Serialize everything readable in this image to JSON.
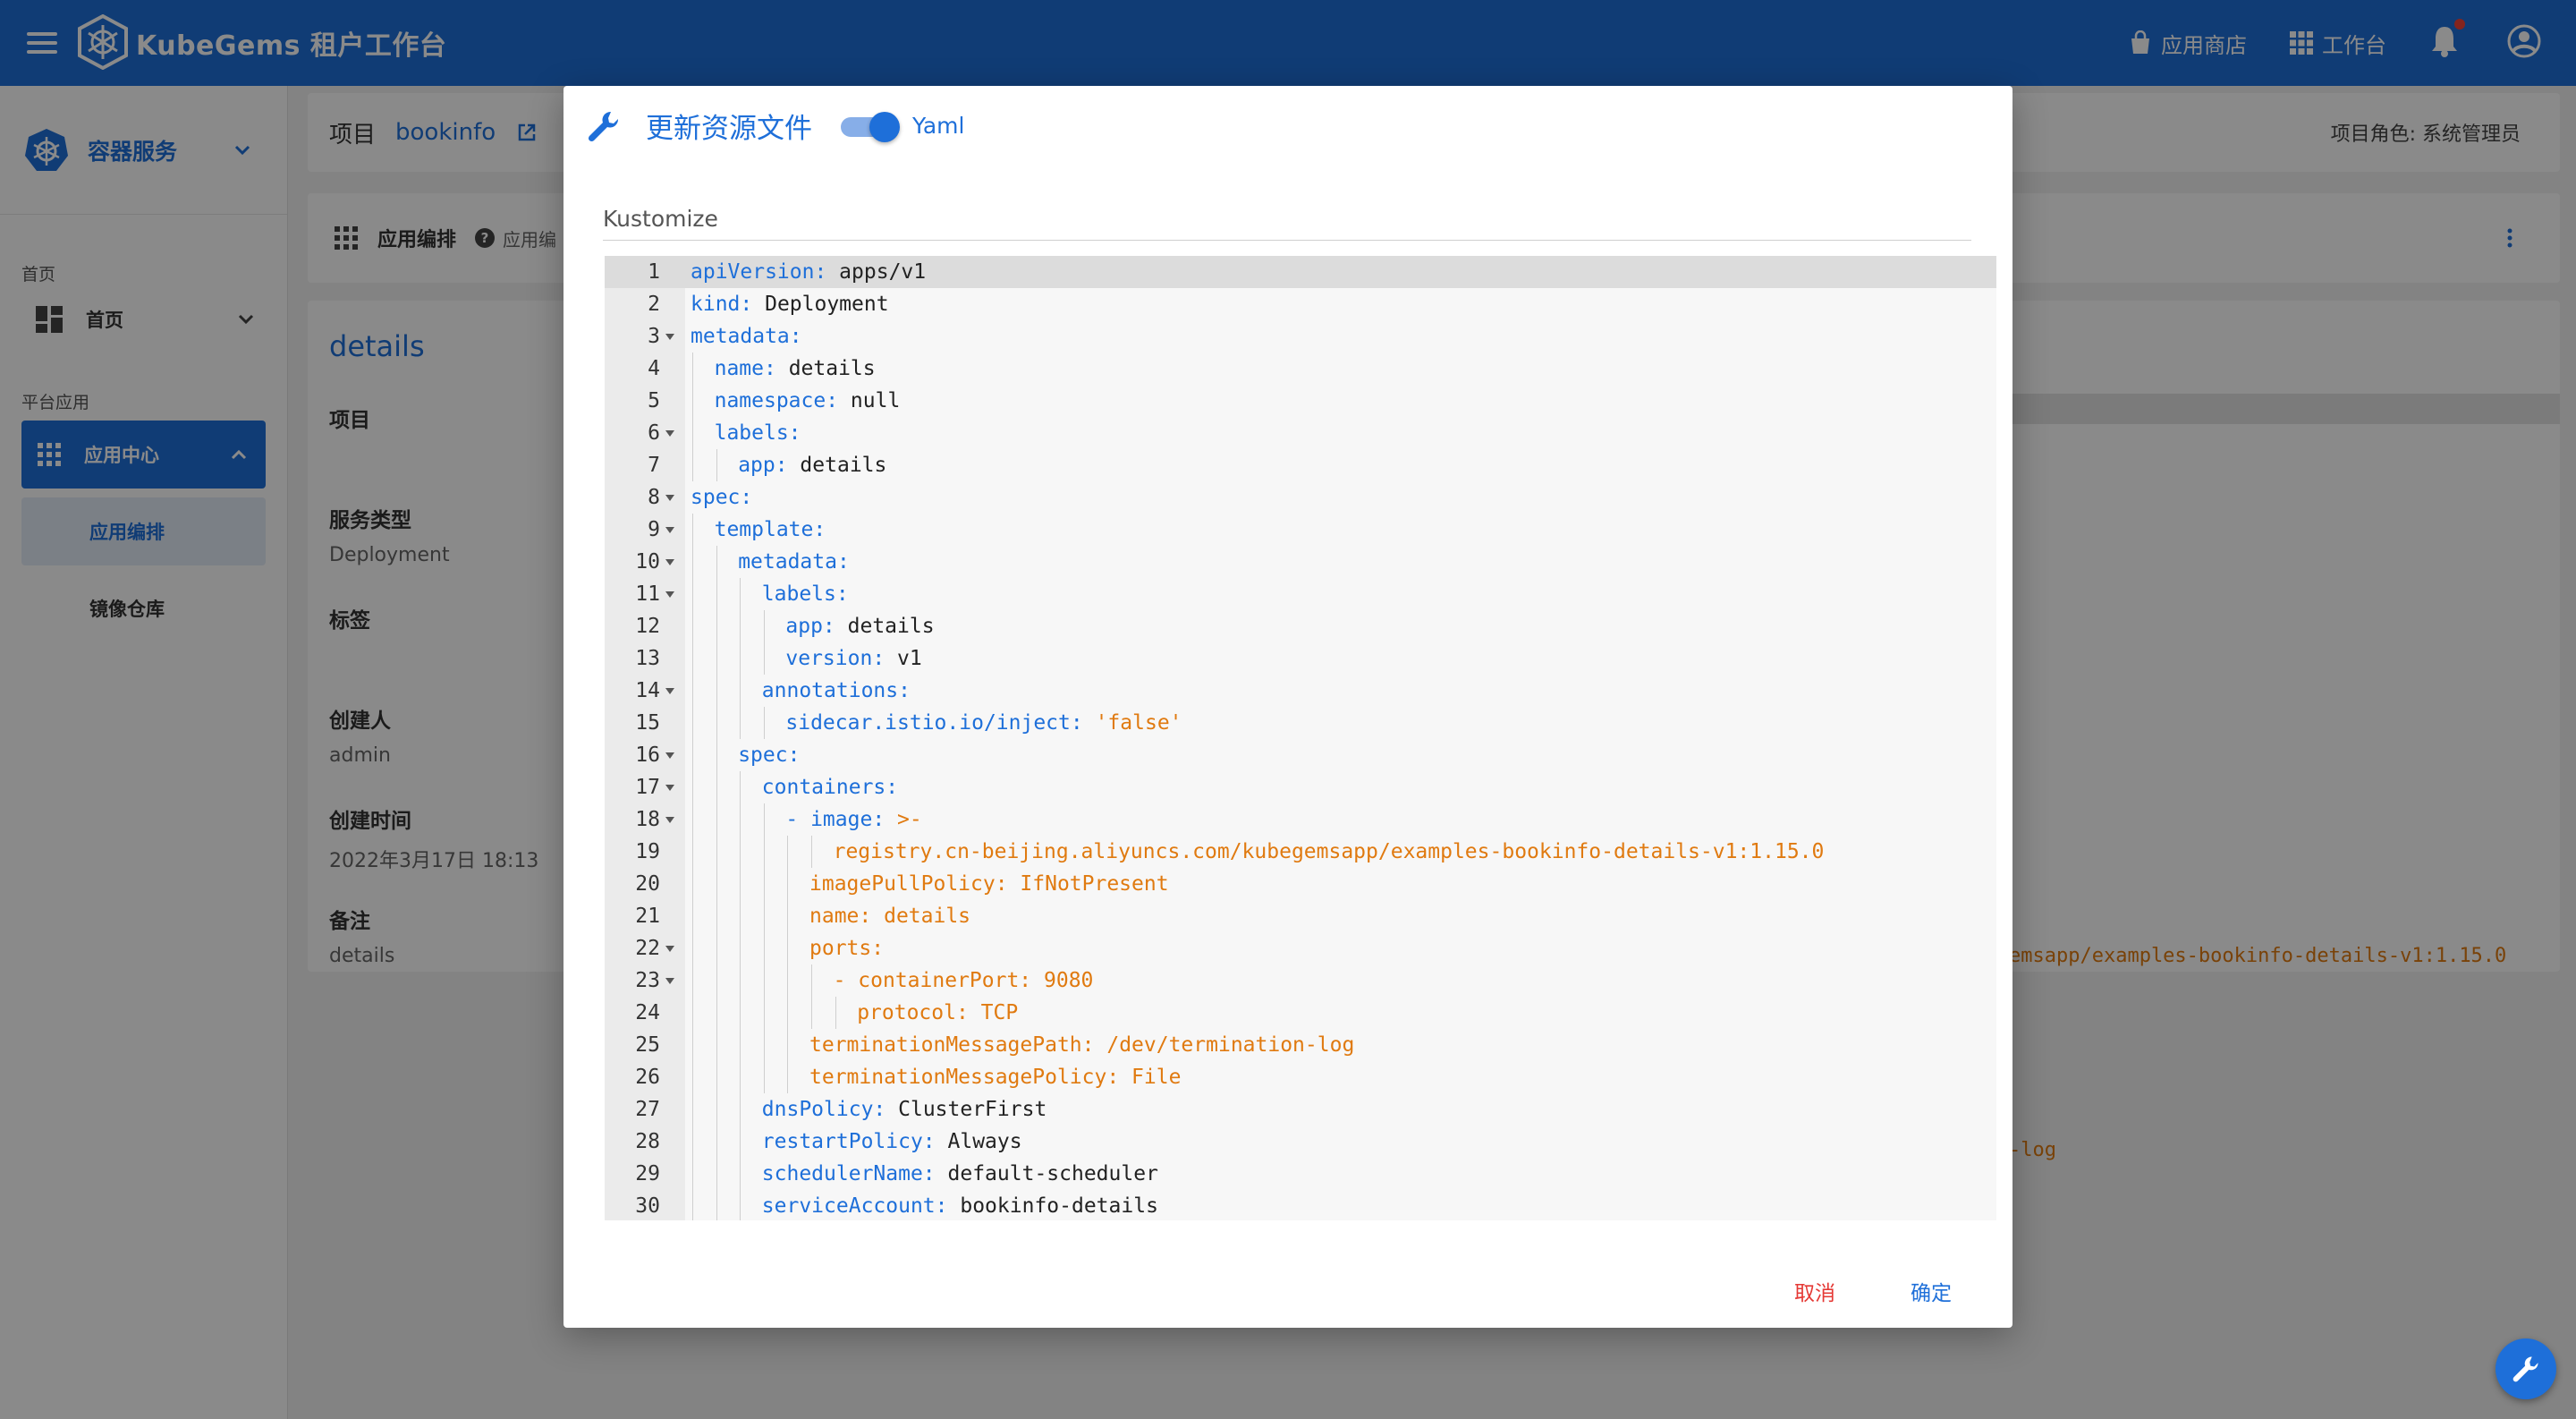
{
  "topbar": {
    "brand": "KubeGems 租户工作台",
    "app_store": "应用商店",
    "workspace": "工作台"
  },
  "sidebar": {
    "header_title": "容器服务",
    "section_home": "首页",
    "home_item": "首页",
    "section_platform": "平台应用",
    "app_center": "应用中心",
    "app_orchestration": "应用编排",
    "image_registry": "镜像仓库"
  },
  "project_bar": {
    "label": "项目",
    "name": "bookinfo",
    "role": "项目角色: 系统管理员"
  },
  "orchestration_bar": {
    "label": "应用编排",
    "sublabel": "应用编"
  },
  "details": {
    "title": "details",
    "fields": [
      {
        "key": "项目",
        "value": ""
      },
      {
        "key": "服务类型",
        "value": "Deployment"
      },
      {
        "key": "标签",
        "value": ""
      },
      {
        "key": "创建人",
        "value": "admin"
      },
      {
        "key": "创建时间",
        "value": "2022年3月17日 18:13"
      },
      {
        "key": "备注",
        "value": "details"
      }
    ],
    "bg_code_1": "emsapp/examples-bookinfo-details-v1:1.15.0",
    "bg_code_2": "-log"
  },
  "dialog": {
    "title": "更新资源文件",
    "toggle_label": "Yaml",
    "toggle_on": true,
    "section_label": "Kustomize",
    "cancel": "取消",
    "confirm": "确定",
    "lines": [
      {
        "n": "1",
        "indent": 0,
        "fold": false,
        "key": "apiVersion:",
        "val": " apps/v1",
        "vt": "t"
      },
      {
        "n": "2",
        "indent": 0,
        "fold": false,
        "key": "kind:",
        "val": " Deployment",
        "vt": "t"
      },
      {
        "n": "3",
        "indent": 0,
        "fold": true,
        "key": "metadata:",
        "val": "",
        "vt": "t"
      },
      {
        "n": "4",
        "indent": 1,
        "fold": false,
        "key": "name:",
        "val": " details",
        "vt": "t"
      },
      {
        "n": "5",
        "indent": 1,
        "fold": false,
        "key": "namespace:",
        "val": " null",
        "vt": "t"
      },
      {
        "n": "6",
        "indent": 1,
        "fold": true,
        "key": "labels:",
        "val": "",
        "vt": "t"
      },
      {
        "n": "7",
        "indent": 2,
        "fold": false,
        "key": "app:",
        "val": " details",
        "vt": "t"
      },
      {
        "n": "8",
        "indent": 0,
        "fold": true,
        "key": "spec:",
        "val": "",
        "vt": "t"
      },
      {
        "n": "9",
        "indent": 1,
        "fold": true,
        "key": "template:",
        "val": "",
        "vt": "t"
      },
      {
        "n": "10",
        "indent": 2,
        "fold": true,
        "key": "metadata:",
        "val": "",
        "vt": "t"
      },
      {
        "n": "11",
        "indent": 3,
        "fold": true,
        "key": "labels:",
        "val": "",
        "vt": "t"
      },
      {
        "n": "12",
        "indent": 4,
        "fold": false,
        "key": "app:",
        "val": " details",
        "vt": "t"
      },
      {
        "n": "13",
        "indent": 4,
        "fold": false,
        "key": "version:",
        "val": " v1",
        "vt": "t"
      },
      {
        "n": "14",
        "indent": 3,
        "fold": true,
        "key": "annotations:",
        "val": "",
        "vt": "t"
      },
      {
        "n": "15",
        "indent": 4,
        "fold": false,
        "key": "sidecar.istio.io/inject:",
        "val": " 'false'",
        "vt": "s"
      },
      {
        "n": "16",
        "indent": 2,
        "fold": true,
        "key": "spec:",
        "val": "",
        "vt": "t"
      },
      {
        "n": "17",
        "indent": 3,
        "fold": true,
        "key": "containers:",
        "val": "",
        "vt": "t"
      },
      {
        "n": "18",
        "indent": 4,
        "fold": true,
        "key": "- image:",
        "val": " >-",
        "vt": "s"
      },
      {
        "n": "19",
        "indent": 6,
        "fold": false,
        "key": "",
        "val": "registry.cn-beijing.aliyuncs.com/kubegemsapp/examples-bookinfo-details-v1:1.15.0",
        "vt": "s"
      },
      {
        "n": "20",
        "indent": 5,
        "fold": false,
        "key": "imagePullPolicy:",
        "val": " IfNotPresent",
        "vt": "s",
        "ks": true
      },
      {
        "n": "21",
        "indent": 5,
        "fold": false,
        "key": "name:",
        "val": " details",
        "vt": "s",
        "ks": true
      },
      {
        "n": "22",
        "indent": 5,
        "fold": true,
        "key": "ports:",
        "val": "",
        "vt": "s",
        "ks": true
      },
      {
        "n": "23",
        "indent": 6,
        "fold": true,
        "key": "- containerPort:",
        "val": " 9080",
        "vt": "s",
        "ks": true
      },
      {
        "n": "24",
        "indent": 7,
        "fold": false,
        "key": "protocol:",
        "val": " TCP",
        "vt": "s",
        "ks": true
      },
      {
        "n": "25",
        "indent": 5,
        "fold": false,
        "key": "terminationMessagePath:",
        "val": " /dev/termination-log",
        "vt": "s",
        "ks": true
      },
      {
        "n": "26",
        "indent": 5,
        "fold": false,
        "key": "terminationMessagePolicy:",
        "val": " File",
        "vt": "s",
        "ks": true
      },
      {
        "n": "27",
        "indent": 3,
        "fold": false,
        "key": "dnsPolicy:",
        "val": " ClusterFirst",
        "vt": "t"
      },
      {
        "n": "28",
        "indent": 3,
        "fold": false,
        "key": "restartPolicy:",
        "val": " Always",
        "vt": "t"
      },
      {
        "n": "29",
        "indent": 3,
        "fold": false,
        "key": "schedulerName:",
        "val": " default-scheduler",
        "vt": "t"
      },
      {
        "n": "30",
        "indent": 3,
        "fold": false,
        "key": "serviceAccount:",
        "val": " bookinfo-details",
        "vt": "t"
      }
    ]
  },
  "colors": {
    "primary": "#1e6fd9",
    "danger": "#e53935",
    "yaml_string": "#e07a10"
  }
}
